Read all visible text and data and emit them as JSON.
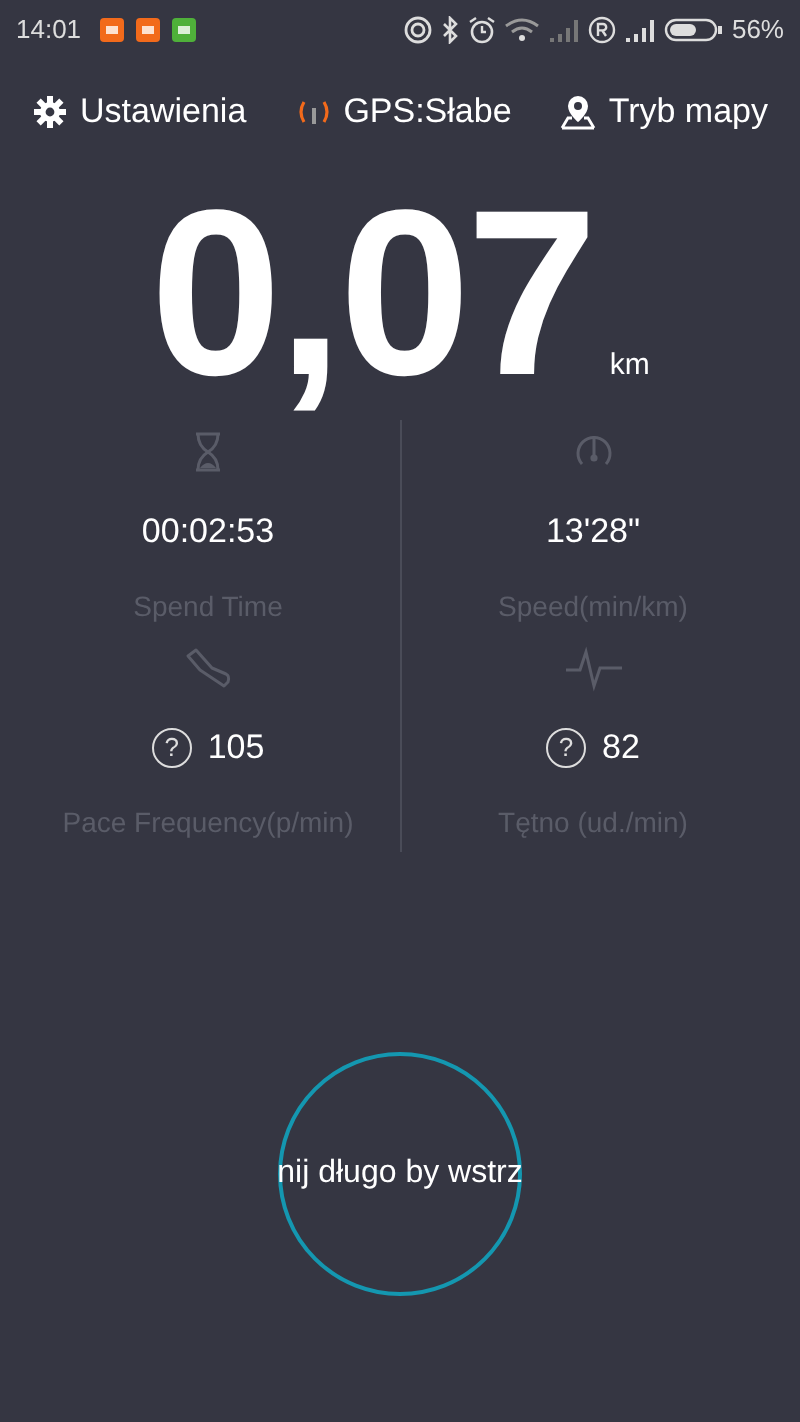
{
  "status_bar": {
    "time": "14:01",
    "battery": "56%"
  },
  "header": [
    {
      "kind": "settings",
      "label": "Ustawienia"
    },
    {
      "kind": "gps",
      "label": "GPS:Słabe"
    },
    {
      "kind": "map",
      "label": "Tryb mapy"
    }
  ],
  "distance": {
    "value": "0,07",
    "unit": "km"
  },
  "stats": [
    {
      "kind": "time",
      "value": "00:02:53",
      "label": "Spend Time"
    },
    {
      "kind": "speed",
      "value": "13'28\"",
      "label": "Speed(min/km)"
    },
    {
      "kind": "pace",
      "value": "105",
      "label": "Pace Frequency(p/min)",
      "help": "?"
    },
    {
      "kind": "heart",
      "value": "82",
      "label": "Tętno (ud./min)",
      "help": "?"
    }
  ],
  "start_button": {
    "label": "nij długo by wstrz"
  }
}
